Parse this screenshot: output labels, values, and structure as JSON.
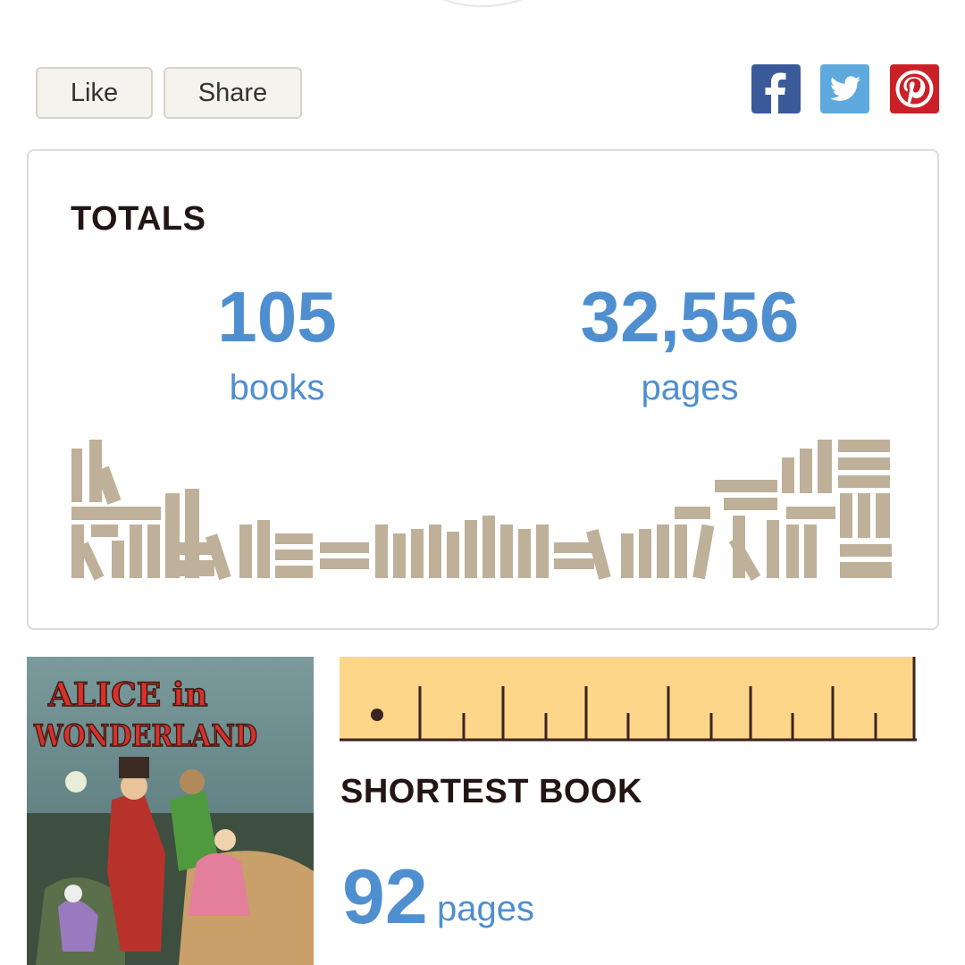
{
  "actions": {
    "like_label": "Like",
    "share_label": "Share"
  },
  "social": [
    {
      "name": "facebook",
      "icon": "facebook-icon",
      "color": "#3b5a9a"
    },
    {
      "name": "twitter",
      "icon": "twitter-icon",
      "color": "#5ea9dd"
    },
    {
      "name": "pinterest",
      "icon": "pinterest-icon",
      "color": "#cb2027"
    }
  ],
  "totals": {
    "title": "TOTALS",
    "books_count": "105",
    "books_label": "books",
    "pages_count": "32,556",
    "pages_label": "pages"
  },
  "shortest": {
    "title": "SHORTEST BOOK",
    "pages": "92",
    "pages_unit": "pages",
    "cover_title_line1": "ALICE in",
    "cover_title_line2": "WONDERLAND"
  },
  "colors": {
    "accent": "#4f8fcf",
    "book": "#bfb09a",
    "ruler": "#fdd68a"
  }
}
